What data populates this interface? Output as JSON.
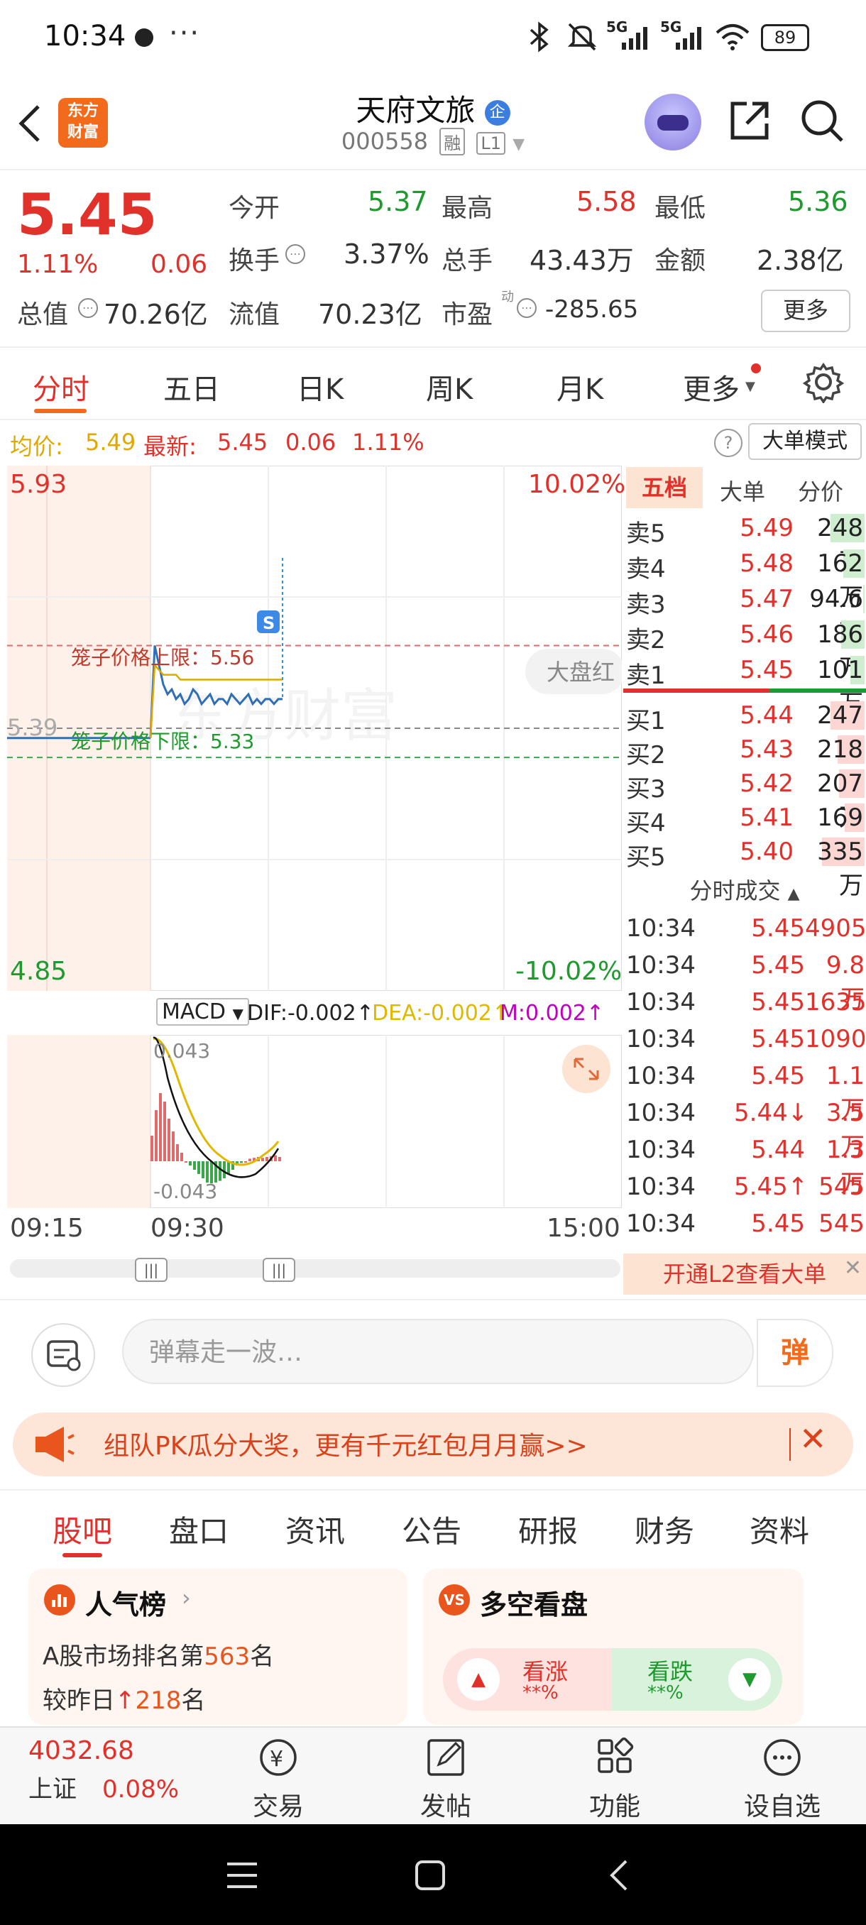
{
  "status_bar": {
    "time": "10:34",
    "more": "···",
    "network_1": "5G",
    "network_2": "5G",
    "battery": "89"
  },
  "header": {
    "logo_line1": "东方",
    "logo_line2": "财富",
    "title": "天府文旅",
    "badge": "企",
    "code": "000558",
    "tag1": "融",
    "tag2": "L1"
  },
  "quote": {
    "price": "5.45",
    "change_pct": "1.11%",
    "change": "0.06",
    "open_label": "今开",
    "open": "5.37",
    "high_label": "最高",
    "high": "5.58",
    "low_label": "最低",
    "low": "5.36",
    "turnover_label": "换手",
    "turnover": "3.37%",
    "volume_label": "总手",
    "volume": "43.43万",
    "amount_label": "金额",
    "amount": "2.38亿",
    "mktcap_label": "总值",
    "mktcap": "70.26亿",
    "float_label": "流值",
    "float": "70.23亿",
    "pe_label": "市盈",
    "pe_sup": "动",
    "pe": "-285.65",
    "more_button": "更多"
  },
  "tabs": [
    "分时",
    "五日",
    "日K",
    "周K",
    "月K",
    "更多"
  ],
  "avg_line": {
    "avg_label": "均价:",
    "avg": "5.49",
    "latest_label": "最新:",
    "latest": "5.45",
    "chg": "0.06",
    "pct": "1.11%",
    "help": "?",
    "big_order_mode": "大单模式"
  },
  "chart": {
    "y_top": "5.93",
    "y_bottom": "4.85",
    "pct_top": "10.02%",
    "pct_bottom": "-10.02%",
    "prev_close_label": "5.39",
    "upper_limit_label": "笼子价格上限：5.56",
    "lower_limit_label": "笼子价格下限：5.33",
    "market_red_label": "大盘红",
    "watermark": "东方财富",
    "s_marker": "S",
    "time_start": "09:15",
    "time_mid": "09:30",
    "time_end": "15:00"
  },
  "chart_data": {
    "type": "line",
    "x": [
      "09:25",
      "09:30",
      "09:31",
      "09:32",
      "09:33",
      "09:34",
      "09:35",
      "09:36",
      "09:37",
      "09:38",
      "09:39",
      "09:40",
      "09:41",
      "09:42",
      "09:43",
      "09:44",
      "09:45",
      "09:46",
      "09:47",
      "09:48",
      "09:49",
      "09:50",
      "09:51",
      "09:52",
      "09:53",
      "09:54",
      "09:55",
      "09:56",
      "09:57",
      "09:58",
      "09:59",
      "10:00"
    ],
    "series": [
      {
        "name": "price",
        "values": [
          5.37,
          5.56,
          5.52,
          5.48,
          5.46,
          5.47,
          5.45,
          5.46,
          5.44,
          5.45,
          5.47,
          5.46,
          5.44,
          5.45,
          5.46,
          5.44,
          5.45,
          5.45,
          5.44,
          5.46,
          5.45,
          5.44,
          5.45,
          5.46,
          5.44,
          5.45,
          5.44,
          5.45,
          5.45,
          5.44,
          5.45,
          5.45
        ]
      },
      {
        "name": "avg",
        "values": [
          5.37,
          5.52,
          5.51,
          5.5,
          5.5,
          5.5,
          5.5,
          5.49,
          5.49,
          5.49,
          5.49,
          5.49,
          5.49,
          5.49,
          5.49,
          5.49,
          5.49,
          5.49,
          5.49,
          5.49,
          5.49,
          5.49,
          5.49,
          5.49,
          5.49,
          5.49,
          5.49,
          5.49,
          5.49,
          5.49,
          5.49,
          5.49
        ]
      }
    ],
    "ylim": [
      4.85,
      5.93
    ],
    "prev_close": 5.39,
    "upper_limit": 5.56,
    "lower_limit": 5.33
  },
  "macd": {
    "selector": "MACD",
    "dif": "DIF:-0.002↑",
    "dea": "DEA:-0.002↑",
    "m": "M:0.002↑",
    "top_label": "0.043",
    "bottom_label": "-0.043"
  },
  "order_book": {
    "tabs": [
      "五档",
      "大单",
      "分价"
    ],
    "sells": [
      {
        "label": "卖5",
        "price": "5.49",
        "vol": "248万",
        "fill": 0.48
      },
      {
        "label": "卖4",
        "price": "5.48",
        "vol": "162万",
        "fill": 0.3
      },
      {
        "label": "卖3",
        "price": "5.47",
        "vol": "94.6万",
        "fill": 0.02
      },
      {
        "label": "卖2",
        "price": "5.46",
        "vol": "186万",
        "fill": 0.33
      },
      {
        "label": "卖1",
        "price": "5.45",
        "vol": "101万",
        "fill": 0.2
      }
    ],
    "buys": [
      {
        "label": "买1",
        "price": "5.44",
        "vol": "247万",
        "fill": 0.48
      },
      {
        "label": "买2",
        "price": "5.43",
        "vol": "218万",
        "fill": 0.38
      },
      {
        "label": "买3",
        "price": "5.42",
        "vol": "207万",
        "fill": 0.36
      },
      {
        "label": "买4",
        "price": "5.41",
        "vol": "169万",
        "fill": 0.28
      },
      {
        "label": "买5",
        "price": "5.40",
        "vol": "335万",
        "fill": 0.6
      }
    ],
    "ticks_title": "分时成交",
    "ticks": [
      {
        "t": "10:34",
        "p": "5.45",
        "v": "4905"
      },
      {
        "t": "10:34",
        "p": "5.45",
        "v": "9.8万"
      },
      {
        "t": "10:34",
        "p": "5.45",
        "v": "1635"
      },
      {
        "t": "10:34",
        "p": "5.45",
        "v": "1090"
      },
      {
        "t": "10:34",
        "p": "5.45",
        "v": "1.1万"
      },
      {
        "t": "10:34",
        "p": "5.44↓",
        "v": "3.5万"
      },
      {
        "t": "10:34",
        "p": "5.44",
        "v": "1.3万"
      },
      {
        "t": "10:34",
        "p": "5.45↑",
        "v": "545"
      },
      {
        "t": "10:34",
        "p": "5.45",
        "v": "545"
      }
    ],
    "l2_promo": "开通L2查看大单"
  },
  "danmu": {
    "placeholder": "弹幕走一波…",
    "button": "弹"
  },
  "banner": {
    "text": "组队PK瓜分大奖，更有千元红包月月赢>>"
  },
  "bottom_tabs": [
    "股吧",
    "盘口",
    "资讯",
    "公告",
    "研报",
    "财务",
    "资料"
  ],
  "cards": {
    "popular_title": "人气榜",
    "popular_line1_prefix": "A股市场排名第",
    "popular_rank": "563",
    "popular_line1_suffix": "名",
    "popular_line2_prefix": "较昨日",
    "popular_change": "218",
    "popular_line2_suffix": "名",
    "sentiment_title": "多空看盘",
    "bull_label": "看涨",
    "bull_value": "**%",
    "bear_label": "看跌",
    "bear_value": "**%"
  },
  "bottom_nav": {
    "index_value": "4032.68",
    "index_name": "上证",
    "index_pct": "0.08%",
    "trade": "交易",
    "post": "发帖",
    "functions": "功能",
    "watchlist": "设自选"
  },
  "colors": {
    "up": "#e0312b",
    "down": "#1f9a2e",
    "accent": "#f26a1b",
    "avg_line": "#e0a800",
    "price_line": "#2e6fb5"
  }
}
